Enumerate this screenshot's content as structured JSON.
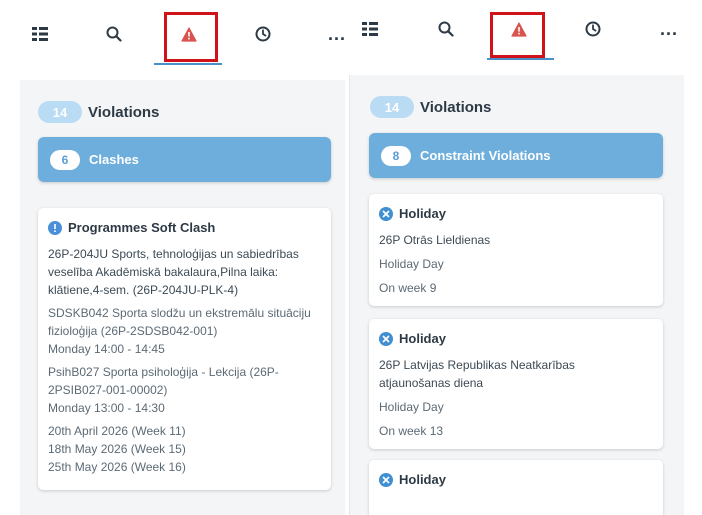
{
  "left": {
    "toolbar": {
      "icons": [
        "list-icon",
        "search-icon",
        "warning-icon",
        "clock-icon",
        "more-icon"
      ],
      "more_label": "..."
    },
    "violations": {
      "count": "14",
      "label": "Violations"
    },
    "group": {
      "count": "6",
      "label": "Clashes"
    },
    "card": {
      "title": "Programmes Soft Clash",
      "icon": "info-icon",
      "programme": [
        "26P-204JU Sports, tehnoloģijas un sabiedrības",
        "veselība Akadēmiskā bakalaura,Pilna laika:",
        "klātiene,4-sem. (26P-204JU-PLK-4)"
      ],
      "session1": [
        "SDSKB042 Sporta slodžu un ekstremālu situāciju",
        "fizioloģija (26P-2SDSB042-001)",
        "Monday 14:00 - 14:45"
      ],
      "session2": [
        "PsihB027 Sporta psiholoģija - Lekcija (26P-",
        "2PSIB027-001-00002)",
        "Monday 13:00 - 14:30"
      ],
      "dates": [
        "20th April 2026 (Week 11)",
        "18th May 2026 (Week 15)",
        "25th May 2026 (Week 16)"
      ]
    }
  },
  "right": {
    "toolbar": {
      "icons": [
        "list-icon",
        "search-icon",
        "warning-icon",
        "clock-icon",
        "more-icon"
      ],
      "more_label": "..."
    },
    "violations": {
      "count": "14",
      "label": "Violations"
    },
    "group": {
      "count": "8",
      "label": "Constraint Violations"
    },
    "cards": [
      {
        "title": "Holiday",
        "icon": "error-icon",
        "name": [
          "26P Otrās Lieldienas"
        ],
        "type": "Holiday Day",
        "week": "On week 9"
      },
      {
        "title": "Holiday",
        "icon": "error-icon",
        "name": [
          "26P Latvijas Republikas Neatkarības",
          "atjaunošanas diena"
        ],
        "type": "Holiday Day",
        "week": "On week 13"
      },
      {
        "title": "Holiday",
        "icon": "error-icon"
      }
    ]
  },
  "colors": {
    "accent": "#6eaedd",
    "pill": "#b9dbf3",
    "highlight": "#d0121a",
    "warning": "#d9534f",
    "info": "#4a90d9",
    "error": "#3f8fd2"
  }
}
